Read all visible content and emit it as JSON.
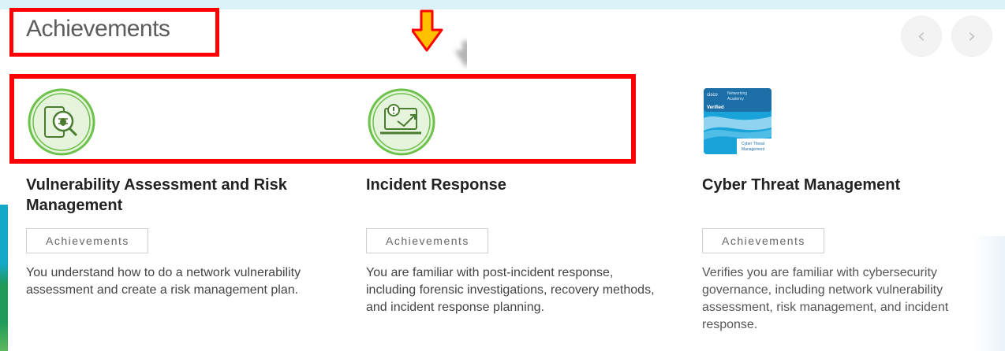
{
  "page": {
    "title": "Achievements"
  },
  "nav": {
    "prev_symbol": "‹",
    "next_symbol": "›"
  },
  "cards": [
    {
      "title": "Vulnerability Assessment and Risk Management",
      "tag": "Achievements",
      "description": "You understand how to do a network vulnerability assessment and create a risk management plan.",
      "icon": "vulnerability-bug-device-icon"
    },
    {
      "title": "Incident Response",
      "tag": "Achievements",
      "description": "You are familiar with post-incident response, including forensic investigations, recovery methods, and incident response planning.",
      "icon": "incident-laptop-alert-icon"
    },
    {
      "title": "Cyber Threat Management",
      "tag": "Achievements",
      "description": "Verifies you are familiar with cybersecurity governance, including network vulnerability assessment, risk management, and incident response.",
      "icon": "cisco-verified-badge-icon",
      "badge": {
        "brand_line1": "Networking",
        "brand_line2": "Academy",
        "cisco": "cisco",
        "verified": "Verified",
        "name_line1": "Cyber Threat",
        "name_line2": "Management"
      }
    }
  ],
  "colors": {
    "accent_red": "#ff0000",
    "icon_green": "#6cc24a",
    "arrow_orange": "#ffc000",
    "badge_blue": "#1aa3d9"
  }
}
